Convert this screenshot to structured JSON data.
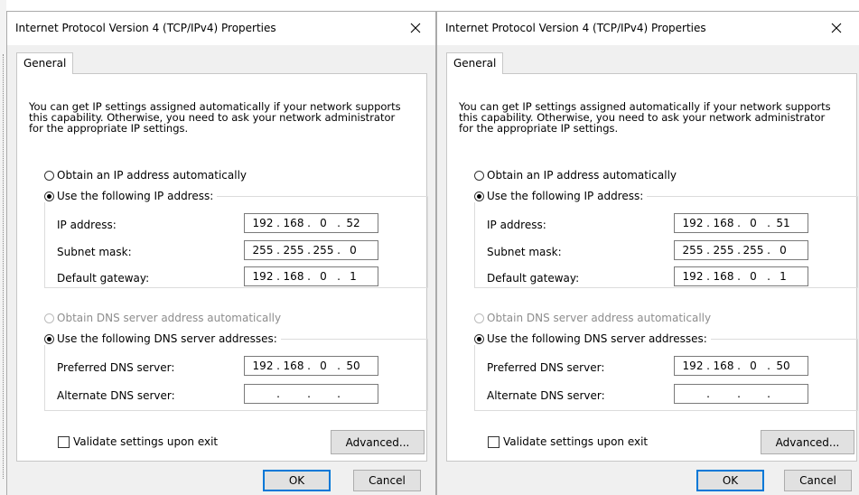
{
  "dialogs": [
    {
      "title": "Internet Protocol Version 4 (TCP/IPv4) Properties",
      "tab_general": "General",
      "description": [
        "You can get IP settings assigned automatically if your network supports",
        "this capability. Otherwise, you need to ask your network administrator",
        "for the appropriate IP settings."
      ],
      "radio_auto_ip": "Obtain an IP address automatically",
      "radio_manual_ip": "Use the following IP address:",
      "label_ip": "IP address:",
      "label_subnet": "Subnet mask:",
      "label_gateway": "Default gateway:",
      "ip_address": [
        "192",
        "168",
        "0",
        "52"
      ],
      "subnet_mask": [
        "255",
        "255",
        "255",
        "0"
      ],
      "default_gateway": [
        "192",
        "168",
        "0",
        "1"
      ],
      "radio_auto_dns": "Obtain DNS server address automatically",
      "radio_manual_dns": "Use the following DNS server addresses:",
      "label_preferred_dns": "Preferred DNS server:",
      "label_alternate_dns": "Alternate DNS server:",
      "preferred_dns": [
        "192",
        "168",
        "0",
        "50"
      ],
      "alternate_dns": [
        "",
        "",
        "",
        ""
      ],
      "validate_label": "Validate settings upon exit",
      "validate_checked": false,
      "advanced_label": "Advanced...",
      "ok_label": "OK",
      "cancel_label": "Cancel",
      "selected_ip_mode": "manual",
      "selected_dns_mode": "manual"
    },
    {
      "title": "Internet Protocol Version 4 (TCP/IPv4) Properties",
      "tab_general": "General",
      "description": [
        "You can get IP settings assigned automatically if your network supports",
        "this capability. Otherwise, you need to ask your network administrator",
        "for the appropriate IP settings."
      ],
      "radio_auto_ip": "Obtain an IP address automatically",
      "radio_manual_ip": "Use the following IP address:",
      "label_ip": "IP address:",
      "label_subnet": "Subnet mask:",
      "label_gateway": "Default gateway:",
      "ip_address": [
        "192",
        "168",
        "0",
        "51"
      ],
      "subnet_mask": [
        "255",
        "255",
        "255",
        "0"
      ],
      "default_gateway": [
        "192",
        "168",
        "0",
        "1"
      ],
      "radio_auto_dns": "Obtain DNS server address automatically",
      "radio_manual_dns": "Use the following DNS server addresses:",
      "label_preferred_dns": "Preferred DNS server:",
      "label_alternate_dns": "Alternate DNS server:",
      "preferred_dns": [
        "192",
        "168",
        "0",
        "50"
      ],
      "alternate_dns": [
        "",
        "",
        "",
        ""
      ],
      "validate_label": "Validate settings upon exit",
      "validate_checked": false,
      "advanced_label": "Advanced...",
      "ok_label": "OK",
      "cancel_label": "Cancel",
      "selected_ip_mode": "manual",
      "selected_dns_mode": "manual"
    }
  ],
  "icons": {
    "close": "close-icon"
  },
  "colors": {
    "ok_border": "#0078d7",
    "disabled_text": "#8d8d8d",
    "panel_background": "#ffffff",
    "dialog_background": "#f0f0f0"
  }
}
